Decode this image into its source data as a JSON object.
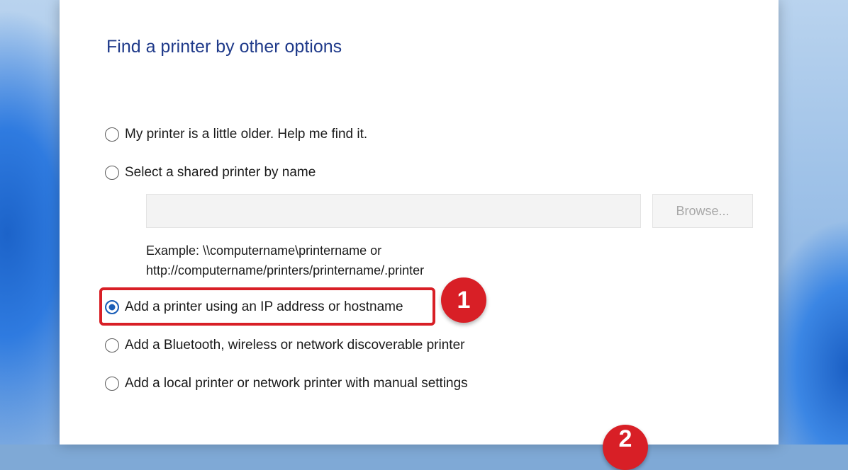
{
  "dialog": {
    "title": "Find a printer by other options",
    "options": [
      {
        "label": "My printer is a little older. Help me find it.",
        "selected": false
      },
      {
        "label": "Select a shared printer by name",
        "selected": false
      },
      {
        "label": "Add a printer using an IP address or hostname",
        "selected": true
      },
      {
        "label": "Add a Bluetooth, wireless or network discoverable printer",
        "selected": false
      },
      {
        "label": "Add a local printer or network printer with manual settings",
        "selected": false
      }
    ],
    "shared_printer_input": {
      "value": "",
      "placeholder": ""
    },
    "browse_label": "Browse...",
    "example_line1": "Example: \\\\computername\\printername or",
    "example_line2": "http://computername/printers/printername/.printer"
  },
  "annotations": {
    "step1": "1",
    "step2": "2",
    "highlight_color": "#d81f26"
  },
  "colors": {
    "title": "#1f3a8a",
    "radio_selected": "#1c5fb8"
  }
}
